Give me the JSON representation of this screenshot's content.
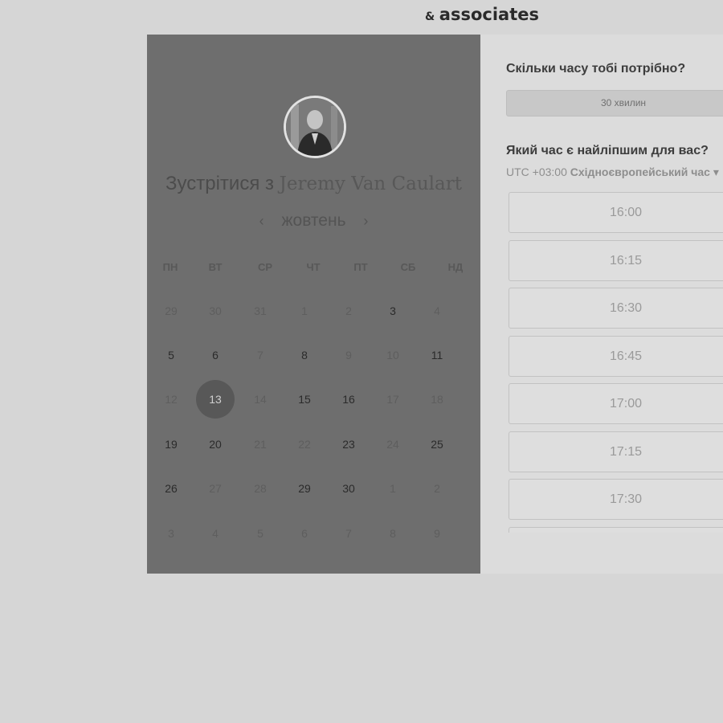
{
  "brand": {
    "amp": "&",
    "word": "associates"
  },
  "host": {
    "meet_prefix": "Зустрітися з",
    "name": "Jeremy Van Caulart"
  },
  "calendar": {
    "prev_icon": "‹",
    "next_icon": "›",
    "month": "жовтень",
    "weekdays": [
      "ПН",
      "ВТ",
      "СР",
      "ЧТ",
      "ПТ",
      "СБ",
      "НД"
    ],
    "weeks": [
      [
        {
          "d": "29",
          "avail": false
        },
        {
          "d": "30",
          "avail": false
        },
        {
          "d": "31",
          "avail": false
        },
        {
          "d": "1",
          "avail": false
        },
        {
          "d": "2",
          "avail": false
        },
        {
          "d": "3",
          "avail": true
        },
        {
          "d": "4",
          "avail": false
        }
      ],
      [
        {
          "d": "5",
          "avail": true
        },
        {
          "d": "6",
          "avail": true
        },
        {
          "d": "7",
          "avail": false
        },
        {
          "d": "8",
          "avail": true
        },
        {
          "d": "9",
          "avail": false
        },
        {
          "d": "10",
          "avail": false
        },
        {
          "d": "11",
          "avail": true
        }
      ],
      [
        {
          "d": "12",
          "avail": false
        },
        {
          "d": "13",
          "avail": true,
          "selected": true
        },
        {
          "d": "14",
          "avail": false
        },
        {
          "d": "15",
          "avail": true
        },
        {
          "d": "16",
          "avail": true
        },
        {
          "d": "17",
          "avail": false
        },
        {
          "d": "18",
          "avail": false
        }
      ],
      [
        {
          "d": "19",
          "avail": true
        },
        {
          "d": "20",
          "avail": true
        },
        {
          "d": "21",
          "avail": false
        },
        {
          "d": "22",
          "avail": false
        },
        {
          "d": "23",
          "avail": true
        },
        {
          "d": "24",
          "avail": false
        },
        {
          "d": "25",
          "avail": true
        }
      ],
      [
        {
          "d": "26",
          "avail": true
        },
        {
          "d": "27",
          "avail": false
        },
        {
          "d": "28",
          "avail": false
        },
        {
          "d": "29",
          "avail": true
        },
        {
          "d": "30",
          "avail": true
        },
        {
          "d": "1",
          "avail": false
        },
        {
          "d": "2",
          "avail": false
        }
      ],
      [
        {
          "d": "3",
          "avail": false
        },
        {
          "d": "4",
          "avail": false
        },
        {
          "d": "5",
          "avail": false
        },
        {
          "d": "6",
          "avail": false
        },
        {
          "d": "7",
          "avail": false
        },
        {
          "d": "8",
          "avail": false
        },
        {
          "d": "9",
          "avail": false
        }
      ]
    ]
  },
  "booking": {
    "duration_question": "Скільки часу тобі потрібно?",
    "duration_value": "30 хвилин",
    "time_question": "Який час є найліпшим для вас?",
    "tz_offset": "UTC +03:00",
    "tz_name": "Східноєвропейський час",
    "tz_caret": "▾",
    "slots": [
      "16:00",
      "16:15",
      "16:30",
      "16:45",
      "17:00",
      "17:15",
      "17:30",
      ""
    ]
  }
}
